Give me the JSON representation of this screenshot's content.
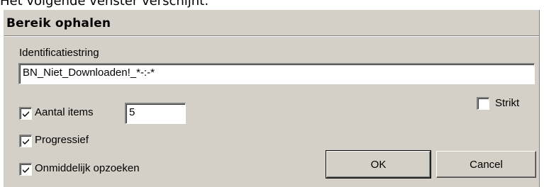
{
  "document": {
    "intro_text": "Het volgende venster verschijnt:"
  },
  "dialog": {
    "title": "Bereik ophalen",
    "identification_label": "Identificatiestring",
    "identification_value": "BN_Niet_Downloaden!_*-:-*",
    "strict": {
      "label": "Strikt",
      "checked": false
    },
    "item_count": {
      "label": "Aantal items",
      "checked": true,
      "value": "5"
    },
    "progressive": {
      "label": "Progressief",
      "checked": true
    },
    "immediate_lookup": {
      "label": "Onmiddelijk opzoeken",
      "checked": true
    },
    "ok_label": "OK",
    "cancel_label": "Cancel"
  }
}
